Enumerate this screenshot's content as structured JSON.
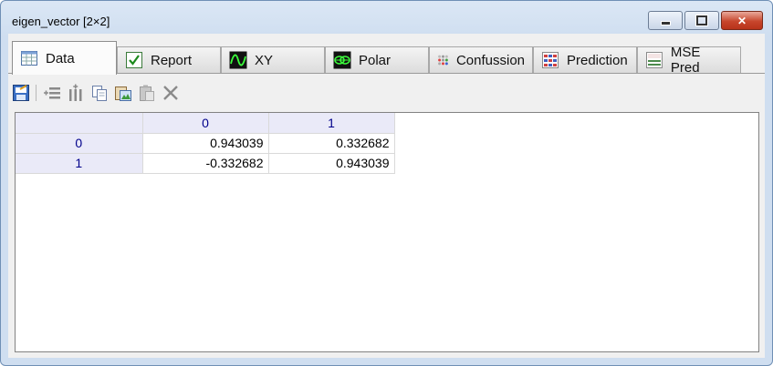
{
  "window": {
    "title": "eigen_vector [2×2]"
  },
  "window_buttons": {
    "minimize": "minimize",
    "maximize": "maximize",
    "close": "close"
  },
  "tabs": [
    {
      "label": "Data",
      "icon": "grid-icon",
      "active": true
    },
    {
      "label": "Report",
      "icon": "checkmark-icon",
      "active": false
    },
    {
      "label": "XY",
      "icon": "sine-wave-icon",
      "active": false
    },
    {
      "label": "Polar",
      "icon": "polar-plot-icon",
      "active": false
    },
    {
      "label": "Confussion",
      "icon": "dots-matrix-icon",
      "active": false
    },
    {
      "label": "Prediction",
      "icon": "colored-grid-icon",
      "active": false
    },
    {
      "label": "MSE Pred",
      "icon": "mse-icon",
      "active": false
    }
  ],
  "toolbar": [
    "edit-image-icon",
    "insert-rows-icon",
    "insert-columns-icon",
    "copy-icon",
    "paste-image-icon",
    "paste-icon",
    "delete-icon"
  ],
  "grid": {
    "column_headers": [
      "0",
      "1"
    ],
    "rows": [
      {
        "header": "0",
        "cells": [
          "0.943039",
          "0.332682"
        ]
      },
      {
        "header": "1",
        "cells": [
          "-0.332682",
          "0.943039"
        ]
      }
    ]
  },
  "colors": {
    "header_bg": "#eaeaf8",
    "header_text": "#00008b",
    "close_button": "#c7462c"
  }
}
